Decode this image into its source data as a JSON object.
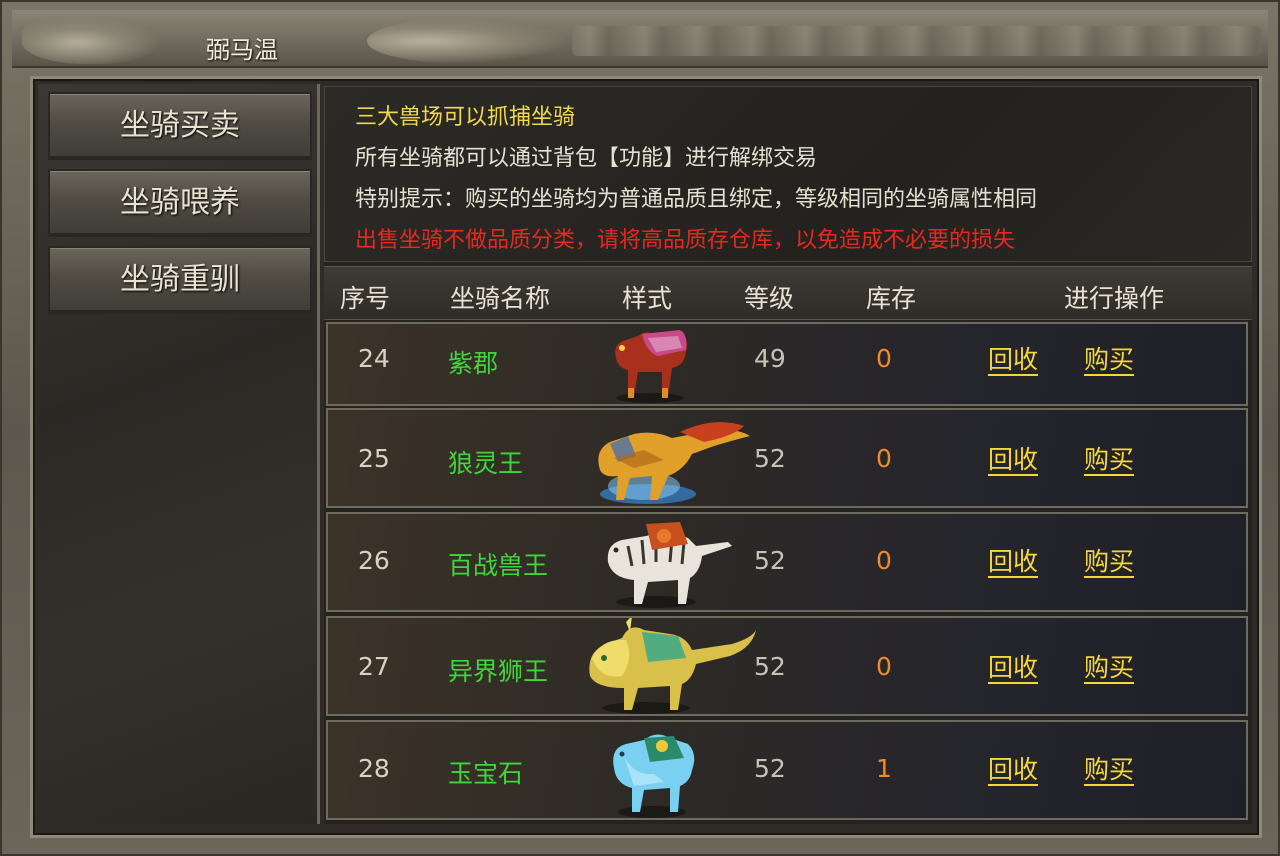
{
  "window": {
    "title": "弼马温"
  },
  "sidebar": {
    "items": [
      {
        "label": "坐骑买卖"
      },
      {
        "label": "坐骑喂养"
      },
      {
        "label": "坐骑重驯"
      }
    ]
  },
  "notice": {
    "line1": "三大兽场可以抓捕坐骑",
    "line2": "所有坐骑都可以通过背包【功能】进行解绑交易",
    "line3": "特别提示：购买的坐骑均为普通品质且绑定，等级相同的坐骑属性相同",
    "line4": "出售坐骑不做品质分类，请将高品质存仓库，以免造成不必要的损失"
  },
  "table": {
    "headers": {
      "no": "序号",
      "name": "坐骑名称",
      "style": "样式",
      "level": "等级",
      "stock": "库存",
      "action": "进行操作"
    },
    "rows": [
      {
        "no": "24",
        "name": "紫郡",
        "level": "49",
        "stock": "0",
        "recycle": "回收",
        "buy": "购买",
        "icon": "red-horse-mount-icon"
      },
      {
        "no": "25",
        "name": "狼灵王",
        "level": "52",
        "stock": "0",
        "recycle": "回收",
        "buy": "购买",
        "icon": "wolf-king-mount-icon"
      },
      {
        "no": "26",
        "name": "百战兽王",
        "level": "52",
        "stock": "0",
        "recycle": "回收",
        "buy": "购买",
        "icon": "white-tiger-mount-icon"
      },
      {
        "no": "27",
        "name": "异界狮王",
        "level": "52",
        "stock": "0",
        "recycle": "回收",
        "buy": "购买",
        "icon": "golden-lion-mount-icon"
      },
      {
        "no": "28",
        "name": "玉宝石",
        "level": "52",
        "stock": "1",
        "recycle": "回收",
        "buy": "购买",
        "icon": "jade-beast-mount-icon"
      }
    ]
  },
  "colors": {
    "name_green": "#3fd63a",
    "stock_orange": "#f08a2a",
    "action_yellow": "#f5d838",
    "warning_red": "#e8281e",
    "notice_yellow": "#f2d94a"
  }
}
